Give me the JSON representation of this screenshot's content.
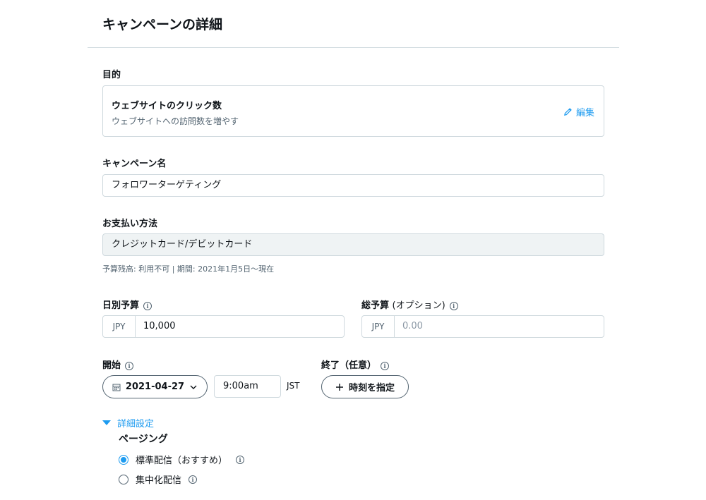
{
  "page": {
    "title": "キャンペーンの詳細"
  },
  "objective": {
    "label": "目的",
    "title": "ウェブサイトのクリック数",
    "description": "ウェブサイトへの訪問数を増やす",
    "edit_label": "編集"
  },
  "campaign_name": {
    "label": "キャンペーン名",
    "value": "フォロワーターゲティング"
  },
  "payment": {
    "label": "お支払い方法",
    "value": "クレジットカード/デビットカード",
    "helper": "予算残高: 利用不可 | 期間: 2021年1月5日～現在"
  },
  "daily_budget": {
    "label": "日別予算",
    "currency": "JPY",
    "value": "10,000"
  },
  "total_budget": {
    "label": "総予算",
    "label_suffix": "(オプション)",
    "currency": "JPY",
    "placeholder": "0.00"
  },
  "start": {
    "label": "開始",
    "date": "2021-04-27",
    "time": "9:00am",
    "timezone": "JST"
  },
  "end": {
    "label": "終了（任意）",
    "button_label": "時刻を指定"
  },
  "advanced": {
    "toggle_label": "詳細設定",
    "pacing_label": "ページング",
    "options": [
      {
        "label": "標準配信（おすすめ）",
        "checked": true
      },
      {
        "label": "集中化配信",
        "checked": false
      }
    ]
  },
  "colors": {
    "accent": "#1d9bf0",
    "border": "#cfd9de",
    "muted": "#536471"
  },
  "icons": [
    "pencil-icon",
    "info-icon",
    "calendar-icon",
    "chevron-down-icon",
    "plus-icon",
    "triangle-down-icon"
  ]
}
